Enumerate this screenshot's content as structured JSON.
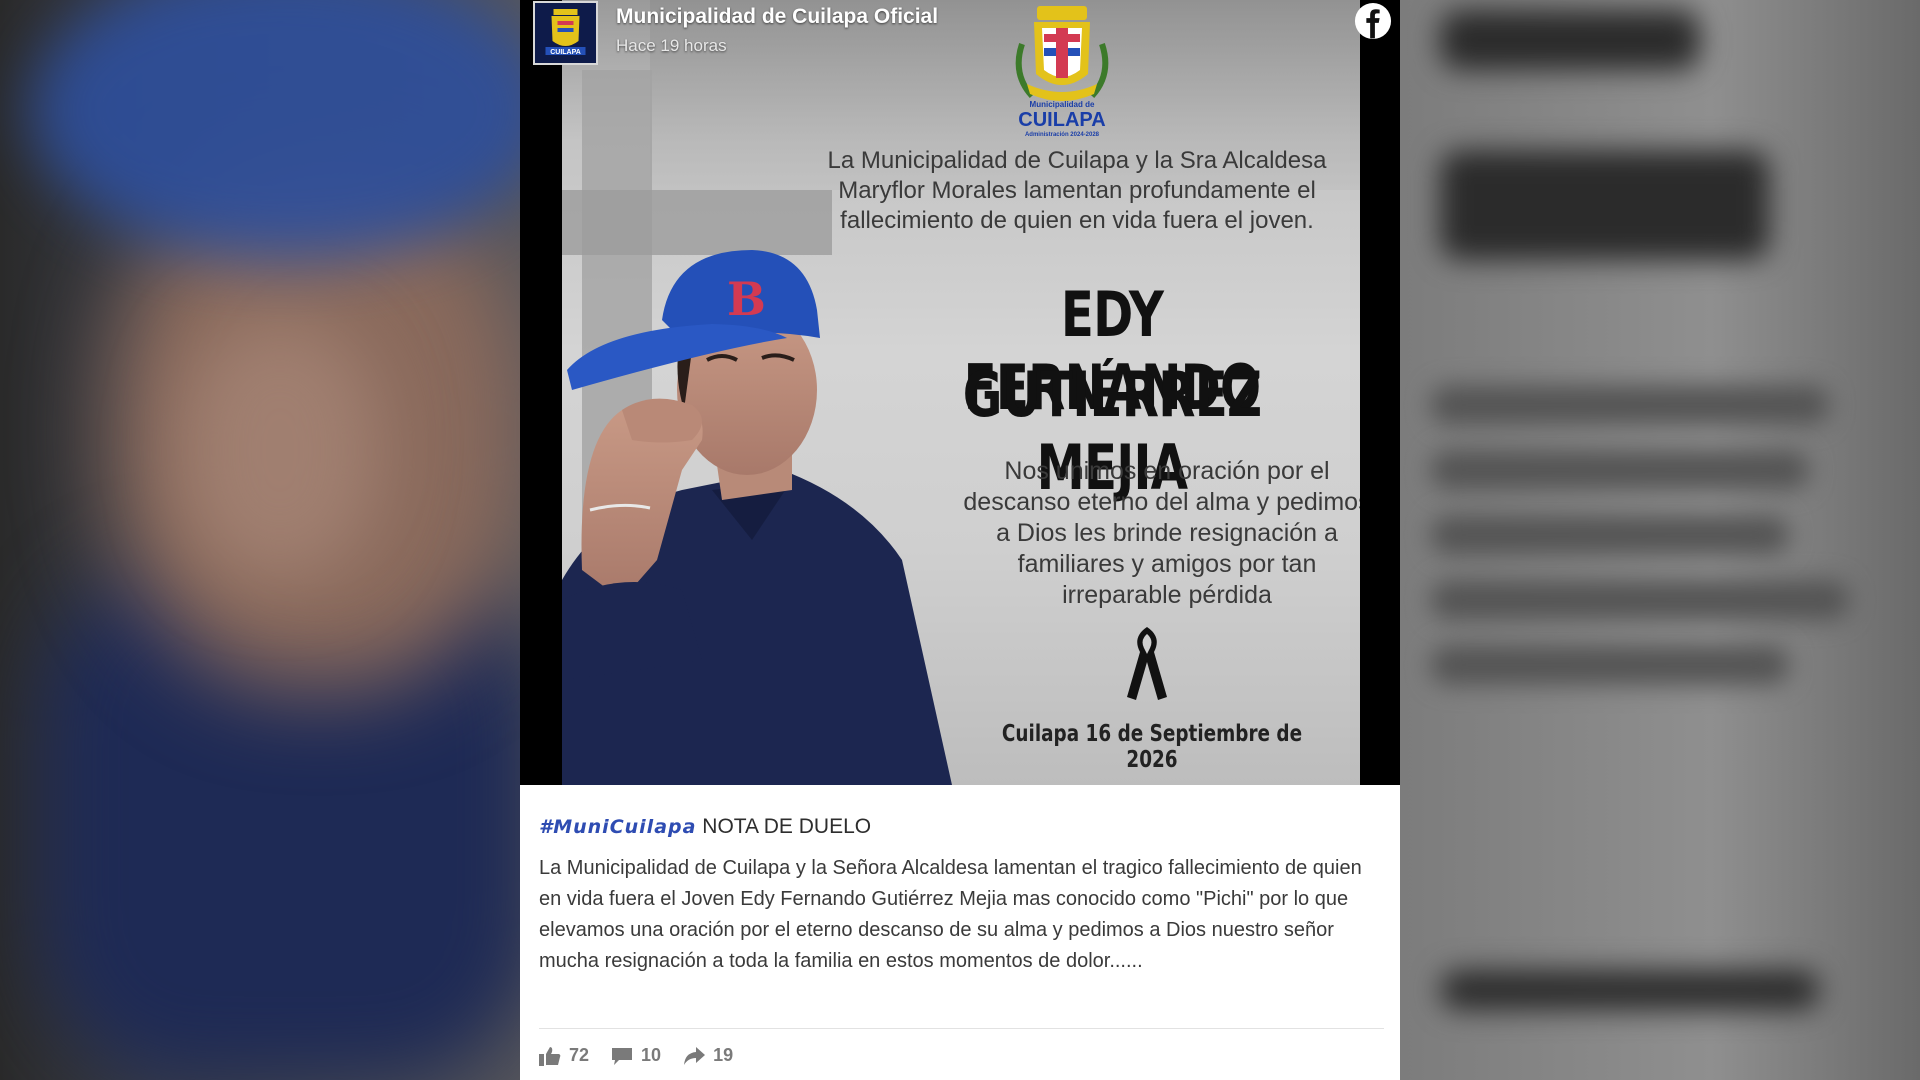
{
  "header": {
    "page_name": "Municipalidad de Cuilapa Oficial",
    "post_time": "Hace 19 horas",
    "logo_icon": "municipality-crest-icon",
    "share_icon": "facebook-icon"
  },
  "poster": {
    "crest_line1": "Municipalidad de",
    "crest_line2": "CUILAPA",
    "crest_line3": "Administración 2024-2028",
    "message_top": "La Municipalidad de Cuilapa y la Sra Alcaldesa Maryflor Morales lamentan profundamente el fallecimiento de quien en vida fuera el joven.",
    "name_line1": "EDY FERNANDO",
    "name_line2": "GUTIÉRREZ MEJIA",
    "message_bottom": "Nos unimos en oración por el descanso eterno del alma y pedimos a Dios les brinde resignación a familiares y amigos por tan irreparable pérdida",
    "ribbon_icon": "mourning-ribbon-icon",
    "date_line": "Cuilapa 16 de Septiembre de 2026"
  },
  "caption": {
    "hashtag": "#MuniCuilapa",
    "title": "NOTA DE DUELO",
    "body": "La Municipalidad de Cuilapa y la Señora Alcaldesa lamentan el tragico fallecimiento de quien en vida fuera el Joven Edy Fernando Gutiérrez Mejia mas conocido como \"Pichi\" por lo que elevamos una oración por el eterno descanso de su alma y pedimos a Dios nuestro señor mucha resignación a toda la familia en estos momentos de dolor......"
  },
  "reactions": {
    "likes": "72",
    "comments": "10",
    "shares": "19"
  },
  "colors": {
    "hashtag": "#2e4cb2",
    "crest_blue": "#1a3ea8",
    "crest_gold": "#e3c21a"
  }
}
